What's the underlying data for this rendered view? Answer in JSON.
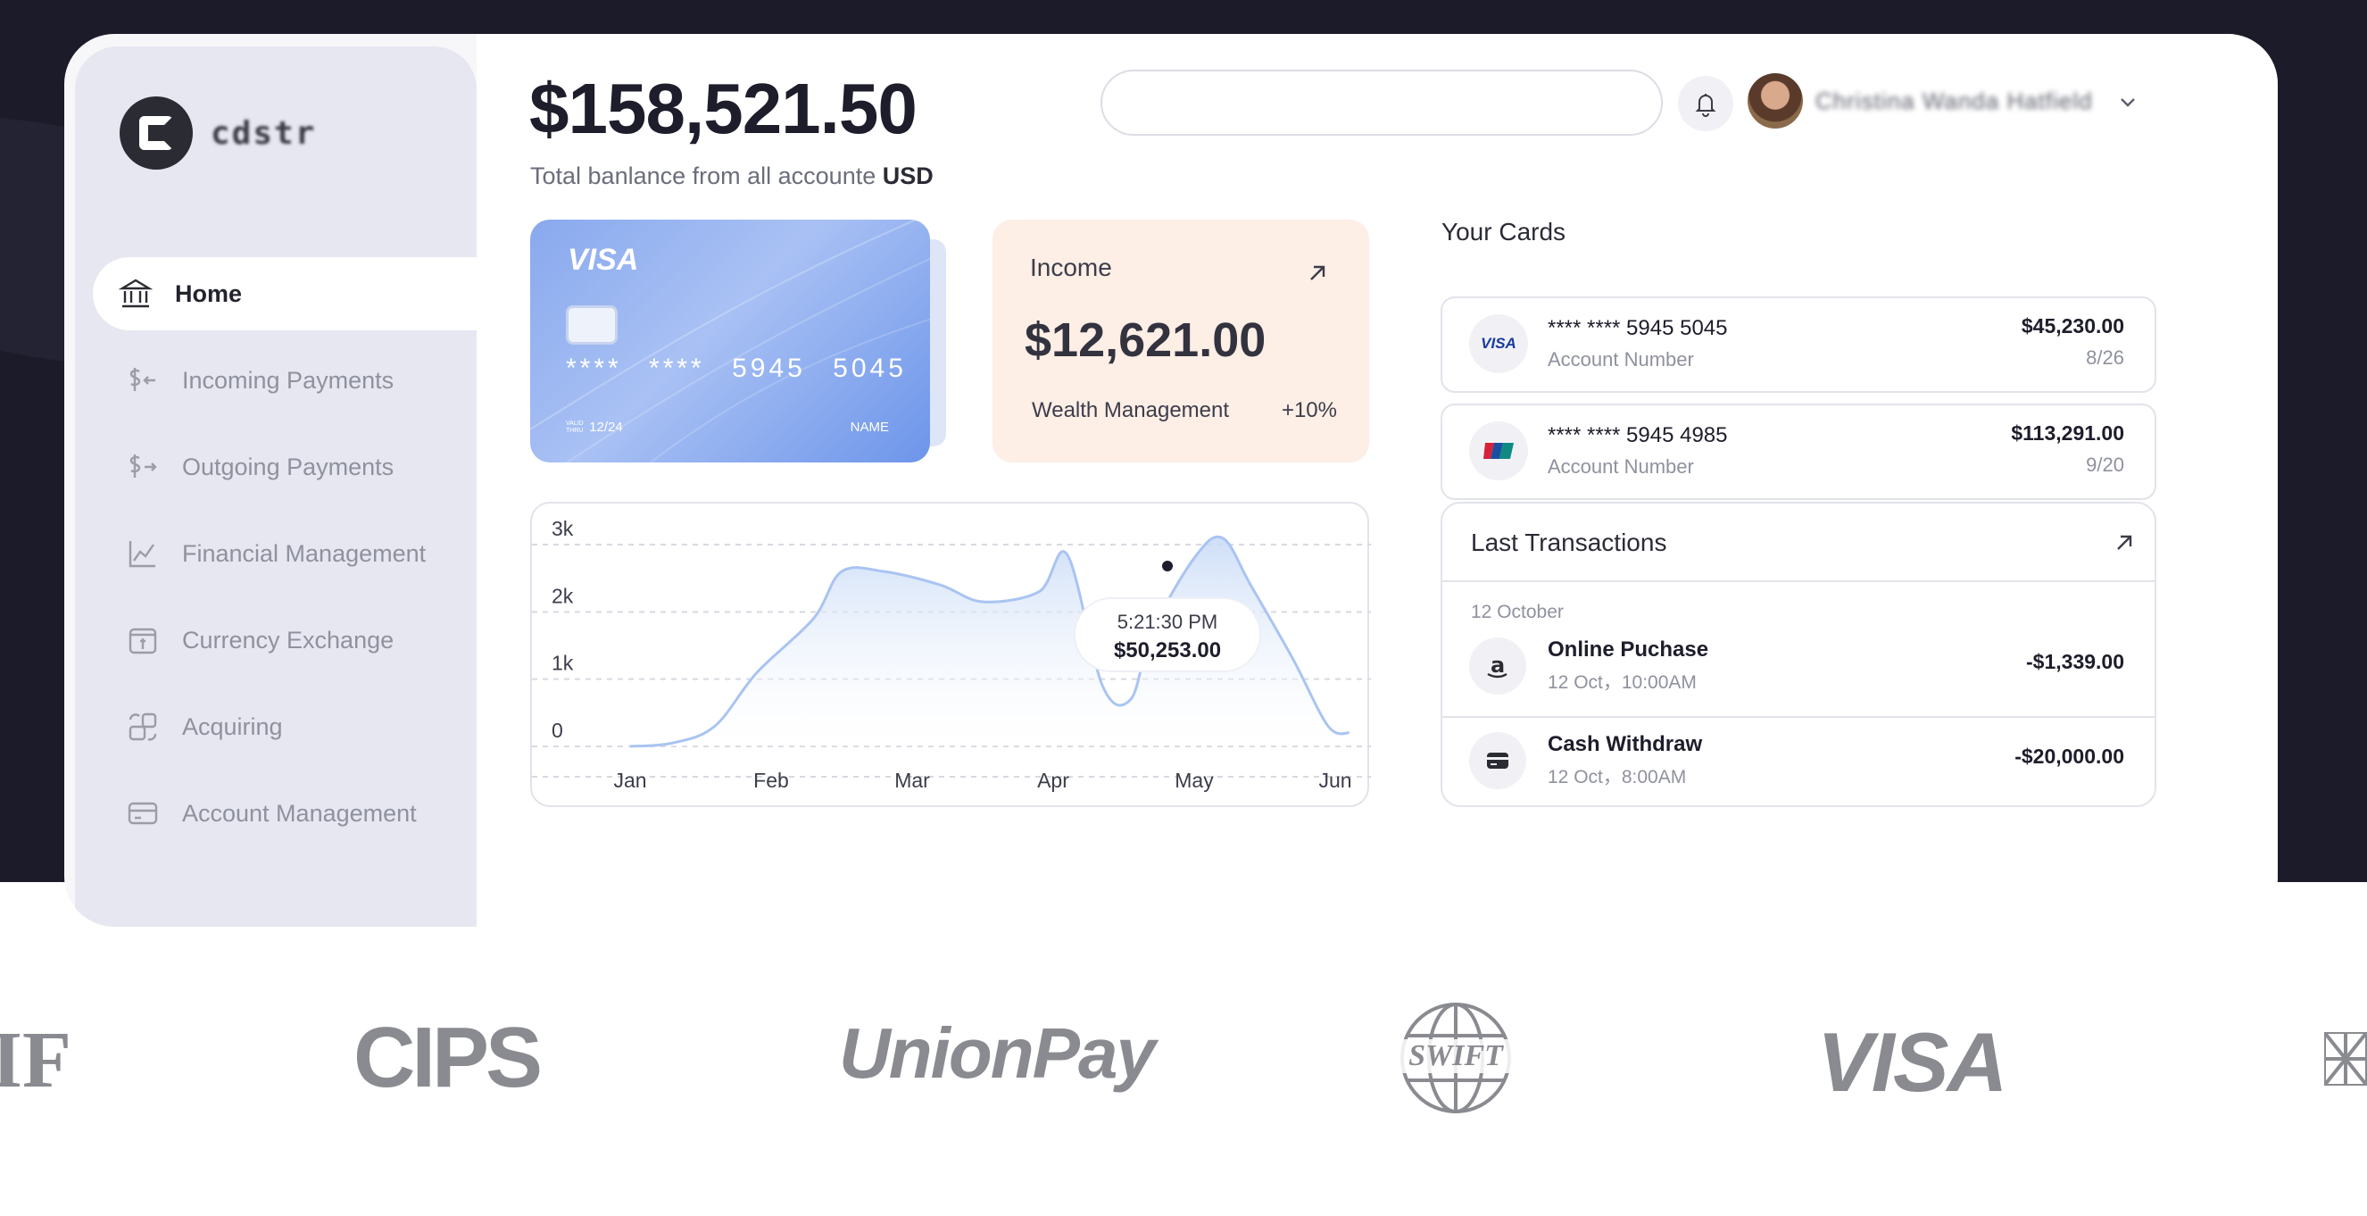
{
  "app": {
    "brand": "cdstr"
  },
  "sidebar": {
    "items": [
      {
        "label": "Home",
        "icon": "bank-icon"
      },
      {
        "label": "Incoming Payments",
        "icon": "dollar-in-icon"
      },
      {
        "label": "Outgoing Payments",
        "icon": "dollar-out-icon"
      },
      {
        "label": "Financial Management",
        "icon": "chart-line-icon"
      },
      {
        "label": "Currency Exchange",
        "icon": "exchange-icon"
      },
      {
        "label": "Acquiring",
        "icon": "acquiring-icon"
      },
      {
        "label": "Account Management",
        "icon": "card-icon"
      }
    ]
  },
  "header": {
    "balance": "$158,521.50",
    "balance_sub": "Total banlance from all accounte",
    "currency": "USD",
    "search_placeholder": "",
    "user_name": "Christina Wanda Hatfield"
  },
  "card": {
    "brand": "VISA",
    "number": "**** **** 5945 5045",
    "valid_label": "VALID THRU",
    "valid": "12/24",
    "name": "NAME"
  },
  "income": {
    "title": "Income",
    "amount": "$12,621.00",
    "label": "Wealth Management",
    "change": "+10%"
  },
  "chart_data": {
    "type": "area",
    "categories": [
      "Jan",
      "Feb",
      "Mar",
      "Apr",
      "May",
      "Jun"
    ],
    "y_ticks": [
      "0",
      "1k",
      "2k",
      "3k"
    ],
    "ylim": [
      0,
      3000
    ],
    "x": [
      0,
      0.3,
      0.6,
      0.9,
      1.3,
      1.5,
      1.8,
      2.2,
      2.5,
      2.9,
      3.1,
      3.35,
      3.55,
      3.7,
      4.0,
      4.2,
      4.4,
      4.7,
      4.95,
      5.1
    ],
    "values": [
      0,
      50,
      300,
      1100,
      1900,
      2600,
      2600,
      2400,
      2150,
      2300,
      2850,
      900,
      700,
      1700,
      2800,
      3100,
      2400,
      1300,
      300,
      200
    ],
    "tooltip": {
      "time": "5:21:30 PM",
      "value": "$50,253.00"
    },
    "grid": true,
    "color": "#a9c4f2"
  },
  "your_cards": {
    "title": "Your Cards",
    "items": [
      {
        "number": "**** **** 5945 5045",
        "label": "Account Number",
        "amount": "$45,230.00",
        "expiry": "8/26",
        "icon": "visa-icon"
      },
      {
        "number": "**** **** 5945 4985",
        "label": "Account Number",
        "amount": "$113,291.00",
        "expiry": "9/20",
        "icon": "unionpay-icon"
      }
    ]
  },
  "transactions": {
    "title": "Last Transactions",
    "date": "12 October",
    "items": [
      {
        "name": "Online Puchase",
        "time": "12 Oct，10:00AM",
        "amount": "-$1,339.00",
        "icon": "amazon-icon"
      },
      {
        "name": "Cash Withdraw",
        "time": "12 Oct，8:00AM",
        "amount": "-$20,000.00",
        "icon": "wallet-icon"
      }
    ]
  },
  "partners": [
    "IF",
    "CIPS",
    "UnionPay",
    "SWIFT",
    "VISA"
  ]
}
